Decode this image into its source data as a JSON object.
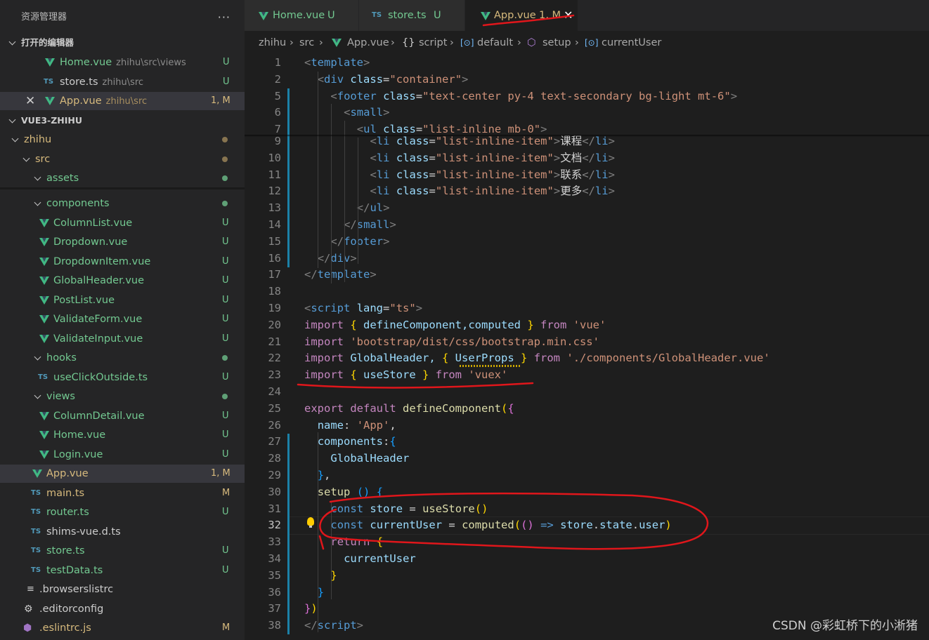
{
  "explorer": {
    "title": "资源管理器",
    "more": "···",
    "open_editors_header": "打开的编辑器",
    "open_editors": [
      {
        "name": "Home.vue",
        "path": "zhihu\\src\\views",
        "status": "U",
        "icon": "vue-icon"
      },
      {
        "name": "store.ts",
        "path": "zhihu\\src",
        "status": "",
        "icon": "ts-icon"
      },
      {
        "name": "App.vue",
        "path": "zhihu\\src",
        "status": "1, M",
        "icon": "vue-icon"
      }
    ],
    "project_header": "VUE3-ZHIHU",
    "tree": [
      {
        "name": "zhihu",
        "type": "folder"
      },
      {
        "name": "src",
        "type": "folder"
      },
      {
        "name": "assets",
        "type": "folder"
      },
      {
        "name": "components",
        "type": "folder"
      },
      {
        "name": "ColumnList.vue",
        "status": "U"
      },
      {
        "name": "Dropdown.vue",
        "status": "U"
      },
      {
        "name": "DropdownItem.vue",
        "status": "U"
      },
      {
        "name": "GlobalHeader.vue",
        "status": "U"
      },
      {
        "name": "PostList.vue",
        "status": "U"
      },
      {
        "name": "ValidateForm.vue",
        "status": "U"
      },
      {
        "name": "ValidateInput.vue",
        "status": "U"
      },
      {
        "name": "hooks",
        "type": "folder"
      },
      {
        "name": "useClickOutside.ts",
        "status": "U"
      },
      {
        "name": "views",
        "type": "folder"
      },
      {
        "name": "ColumnDetail.vue",
        "status": "U"
      },
      {
        "name": "Home.vue",
        "status": "U"
      },
      {
        "name": "Login.vue",
        "status": "U"
      },
      {
        "name": "App.vue",
        "status": "1, M"
      },
      {
        "name": "main.ts",
        "status": "M"
      },
      {
        "name": "router.ts",
        "status": "U"
      },
      {
        "name": "shims-vue.d.ts",
        "status": ""
      },
      {
        "name": "store.ts",
        "status": "U"
      },
      {
        "name": "testData.ts",
        "status": "U"
      },
      {
        "name": ".browserslistrc",
        "status": ""
      },
      {
        "name": ".editorconfig",
        "status": ""
      },
      {
        "name": ".eslintrc.js",
        "status": "M"
      }
    ]
  },
  "tabs": [
    {
      "label": "Home.vue",
      "status": "U"
    },
    {
      "label": "store.ts",
      "status": "U"
    },
    {
      "label": "App.vue",
      "status": "1, M"
    }
  ],
  "breadcrumb": [
    "zhihu",
    "src",
    "App.vue",
    "script",
    "default",
    "setup",
    "currentUser"
  ],
  "code_lines": [
    {
      "n": "1"
    },
    {
      "n": "2"
    },
    {
      "n": "5"
    },
    {
      "n": "6"
    },
    {
      "n": "7"
    },
    {
      "n": "9"
    },
    {
      "n": "10"
    },
    {
      "n": "11"
    },
    {
      "n": "12"
    },
    {
      "n": "13"
    },
    {
      "n": "14"
    },
    {
      "n": "15"
    },
    {
      "n": "16"
    },
    {
      "n": "17"
    },
    {
      "n": "18"
    },
    {
      "n": "19"
    },
    {
      "n": "20"
    },
    {
      "n": "21"
    },
    {
      "n": "22"
    },
    {
      "n": "23"
    },
    {
      "n": "24"
    },
    {
      "n": "25"
    },
    {
      "n": "26"
    },
    {
      "n": "27"
    },
    {
      "n": "28"
    },
    {
      "n": "29"
    },
    {
      "n": "30"
    },
    {
      "n": "31"
    },
    {
      "n": "32"
    },
    {
      "n": "33"
    },
    {
      "n": "34"
    },
    {
      "n": "35"
    },
    {
      "n": "36"
    },
    {
      "n": "37"
    },
    {
      "n": "38"
    }
  ],
  "code": {
    "l1": [
      "<",
      "template",
      ">"
    ],
    "l2": [
      "<",
      "div",
      " ",
      "class",
      "=",
      "\"container\"",
      ">"
    ],
    "l5": [
      "<",
      "footer",
      " ",
      "class",
      "=",
      "\"text-center py-4 text-secondary bg-light mt-6\"",
      ">"
    ],
    "l6": [
      "<",
      "small",
      ">"
    ],
    "l7": [
      "<",
      "ul",
      " ",
      "class",
      "=",
      "\"list-inline mb-0\"",
      ">"
    ],
    "l9": [
      "<",
      "li",
      " ",
      "class",
      "=",
      "\"list-inline-item\"",
      ">",
      "课程",
      "</",
      "li",
      ">"
    ],
    "l10": [
      "<",
      "li",
      " ",
      "class",
      "=",
      "\"list-inline-item\"",
      ">",
      "文档",
      "</",
      "li",
      ">"
    ],
    "l11": [
      "<",
      "li",
      " ",
      "class",
      "=",
      "\"list-inline-item\"",
      ">",
      "联系",
      "</",
      "li",
      ">"
    ],
    "l12": [
      "<",
      "li",
      " ",
      "class",
      "=",
      "\"list-inline-item\"",
      ">",
      "更多",
      "</",
      "li",
      ">"
    ],
    "l13": [
      "</",
      "ul",
      ">"
    ],
    "l14": [
      "</",
      "small",
      ">"
    ],
    "l15": [
      "</",
      "footer",
      ">"
    ],
    "l16": [
      "</",
      "div",
      ">"
    ],
    "l17": [
      "</",
      "template",
      ">"
    ],
    "l19": [
      "<",
      "script",
      " ",
      "lang",
      "=",
      "\"ts\"",
      ">"
    ],
    "l20": [
      "import",
      " ",
      "{",
      " defineComponent,computed ",
      "}",
      " from ",
      "'vue'"
    ],
    "l21": [
      "import",
      " ",
      "'bootstrap/dist/css/bootstrap.min.css'"
    ],
    "l22": [
      "import",
      " GlobalHeader, ",
      "{",
      " ",
      "UserProps",
      " ",
      "}",
      " from ",
      "'./components/GlobalHeader.vue'"
    ],
    "l23": [
      "import",
      " ",
      "{",
      " useStore ",
      "}",
      " from ",
      "'vuex'"
    ],
    "l25": [
      "export",
      " ",
      "default",
      " ",
      "defineComponent",
      "(",
      "{"
    ],
    "l26": [
      "name",
      ": ",
      "'App'",
      ","
    ],
    "l27": [
      "components",
      ":",
      "{"
    ],
    "l28": [
      "GlobalHeader"
    ],
    "l29": [
      "}",
      ","
    ],
    "l30": [
      "setup",
      " ",
      "()",
      " ",
      "{"
    ],
    "l31": [
      "const",
      " ",
      "store",
      " = ",
      "useStore",
      "()"
    ],
    "l32": [
      "const",
      " ",
      "currentUser",
      " = ",
      "computed",
      "(",
      "()",
      " => ",
      "store",
      ".",
      "state",
      ".",
      "user",
      ")"
    ],
    "l33": [
      "return",
      " ",
      "{"
    ],
    "l34": [
      "currentUser"
    ],
    "l35": [
      "}"
    ],
    "l36": [
      "}"
    ],
    "l37": [
      "}",
      ")"
    ],
    "l38": [
      "</",
      "script",
      ">"
    ]
  },
  "watermark": "CSDN @彩虹桥下的小淅猪",
  "colors": {
    "accent_modified": "#d7ba7d",
    "accent_untracked": "#73c991",
    "annotation": "#e0161b"
  }
}
